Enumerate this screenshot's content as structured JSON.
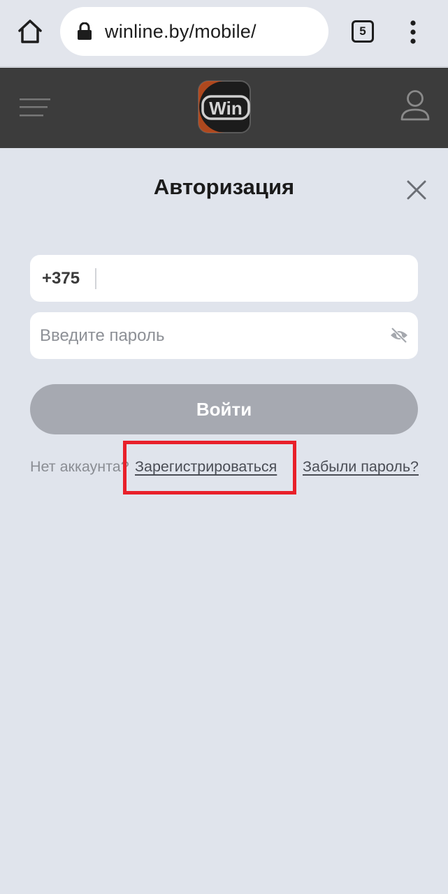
{
  "browser": {
    "url": "winline.by/mobile/",
    "tab_count": "5",
    "icons": {
      "home": "home-icon",
      "lock": "lock-icon",
      "menu": "more-vert-icon"
    }
  },
  "header": {
    "logo_text": "Win",
    "icons": {
      "menu": "hamburger-icon",
      "user": "user-icon"
    }
  },
  "auth": {
    "title": "Авторизация",
    "phone_prefix": "+375",
    "phone_value": "",
    "password_placeholder": "Введите пароль",
    "login_label": "Войти",
    "no_account_text": "Нет аккаунта?",
    "register_label": "Зарегистрироваться",
    "forgot_label": "Забыли пароль?"
  },
  "colors": {
    "page_bg": "#e0e4ec",
    "header_bg": "#3c3c3c",
    "button_disabled": "#a6a9b1",
    "highlight": "#e8202a",
    "logo_orange": "#c8501e"
  }
}
